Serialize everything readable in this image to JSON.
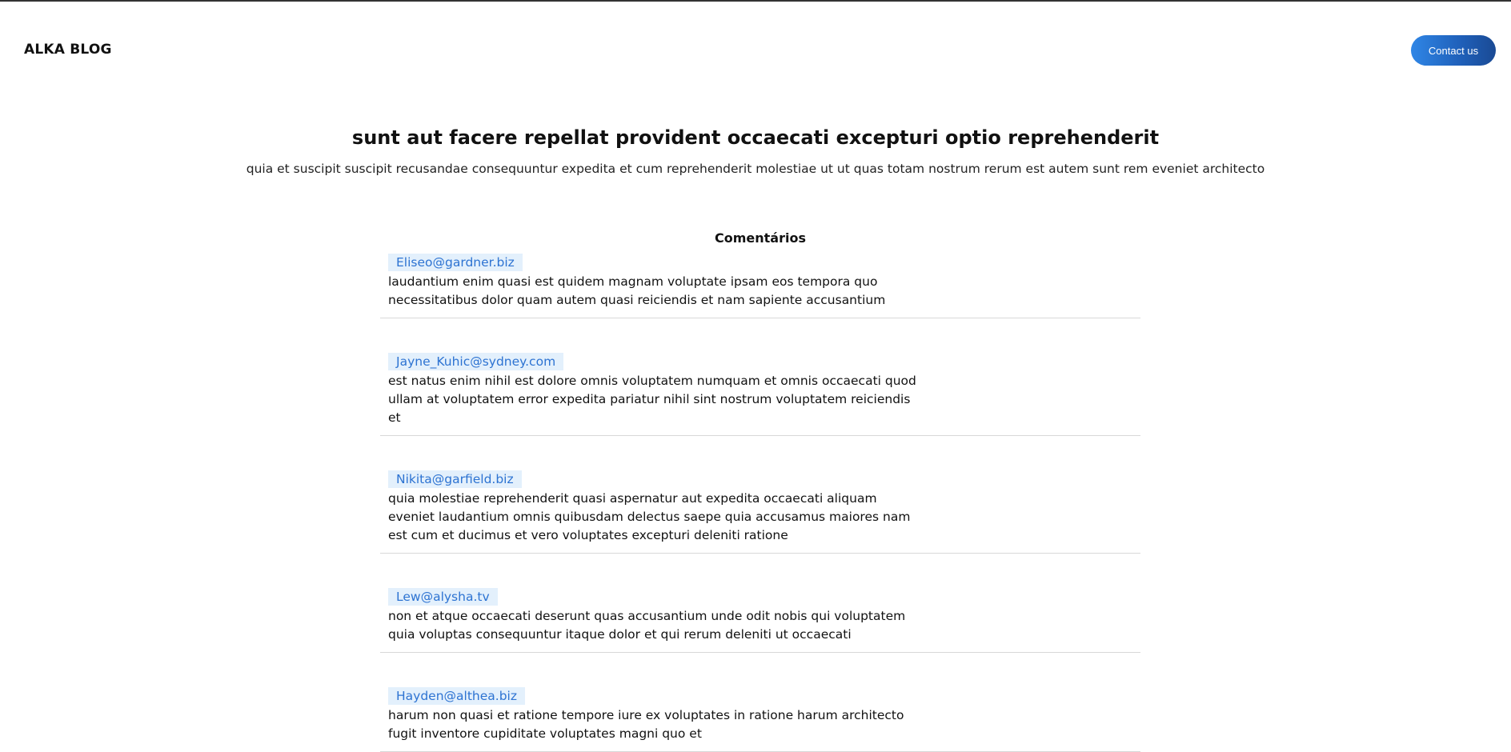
{
  "header": {
    "brand": "ALKA BLOG",
    "contact_label": "Contact us"
  },
  "post": {
    "title": "sunt aut facere repellat provident occaecati excepturi optio reprehenderit",
    "body": "quia et suscipit suscipit recusandae consequuntur expedita et cum reprehenderit molestiae ut ut quas totam nostrum rerum est autem sunt rem eveniet architecto"
  },
  "comments": {
    "title": "Comentários",
    "items": [
      {
        "email": "Eliseo@gardner.biz",
        "body": "laudantium enim quasi est quidem magnam voluptate ipsam eos tempora quo necessitatibus dolor quam autem quasi reiciendis et nam sapiente accusantium"
      },
      {
        "email": "Jayne_Kuhic@sydney.com",
        "body": "est natus enim nihil est dolore omnis voluptatem numquam et omnis occaecati quod ullam at voluptatem error expedita pariatur nihil sint nostrum voluptatem reiciendis et"
      },
      {
        "email": "Nikita@garfield.biz",
        "body": "quia molestiae reprehenderit quasi aspernatur aut expedita occaecati aliquam eveniet laudantium omnis quibusdam delectus saepe quia accusamus maiores nam est cum et ducimus et vero voluptates excepturi deleniti ratione"
      },
      {
        "email": "Lew@alysha.tv",
        "body": "non et atque occaecati deserunt quas accusantium unde odit nobis qui voluptatem quia voluptas consequuntur itaque dolor et qui rerum deleniti ut occaecati"
      },
      {
        "email": "Hayden@althea.biz",
        "body": "harum non quasi et ratione tempore iure ex voluptates in ratione harum architecto fugit inventore cupiditate voluptates magni quo et"
      }
    ]
  }
}
